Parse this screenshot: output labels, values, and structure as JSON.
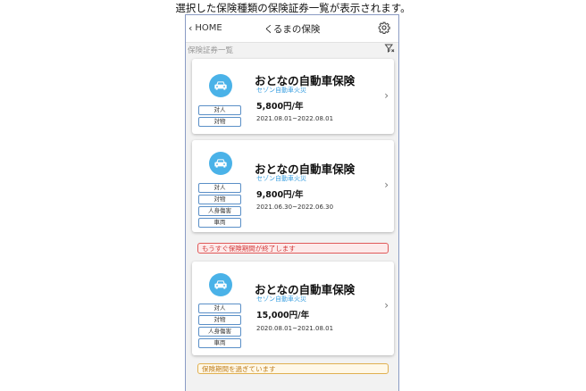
{
  "caption": "選択した保険種類の保険証券一覧が表示されます。",
  "header": {
    "back_label": "HOME",
    "title": "くるまの保険"
  },
  "section": {
    "label": "保険証券一覧"
  },
  "cards": [
    {
      "name": "おとなの自動車保険",
      "company": "セゾン自動車火災",
      "price": "5,800円/年",
      "period": "2021.08.01~2022.08.01",
      "tags": [
        "対人",
        "対物"
      ]
    },
    {
      "name": "おとなの自動車保険",
      "company": "セゾン自動車火災",
      "price": "9,800円/年",
      "period": "2021.06.30~2022.06.30",
      "tags": [
        "対人",
        "対物",
        "人身傷害",
        "車両"
      ]
    },
    {
      "name": "おとなの自動車保険",
      "company": "セゾン自動車火災",
      "price": "15,000円/年",
      "period": "2020.08.01~2021.08.01",
      "tags": [
        "対人",
        "対物",
        "人身傷害",
        "車両"
      ]
    }
  ],
  "alerts": {
    "expiring": "もうすぐ保険期間が終了します",
    "expired": "保険期間を過ぎています"
  },
  "colors": {
    "accent": "#4ab2e8",
    "tag_border": "#5a8fc7",
    "alert_red": "#e05a5a",
    "alert_orange": "#e0b050"
  },
  "icons": {
    "back": "chevron-left-icon",
    "settings": "gear-icon",
    "filter": "filter-icon",
    "car": "car-icon",
    "card_arrow": "chevron-right-icon"
  }
}
